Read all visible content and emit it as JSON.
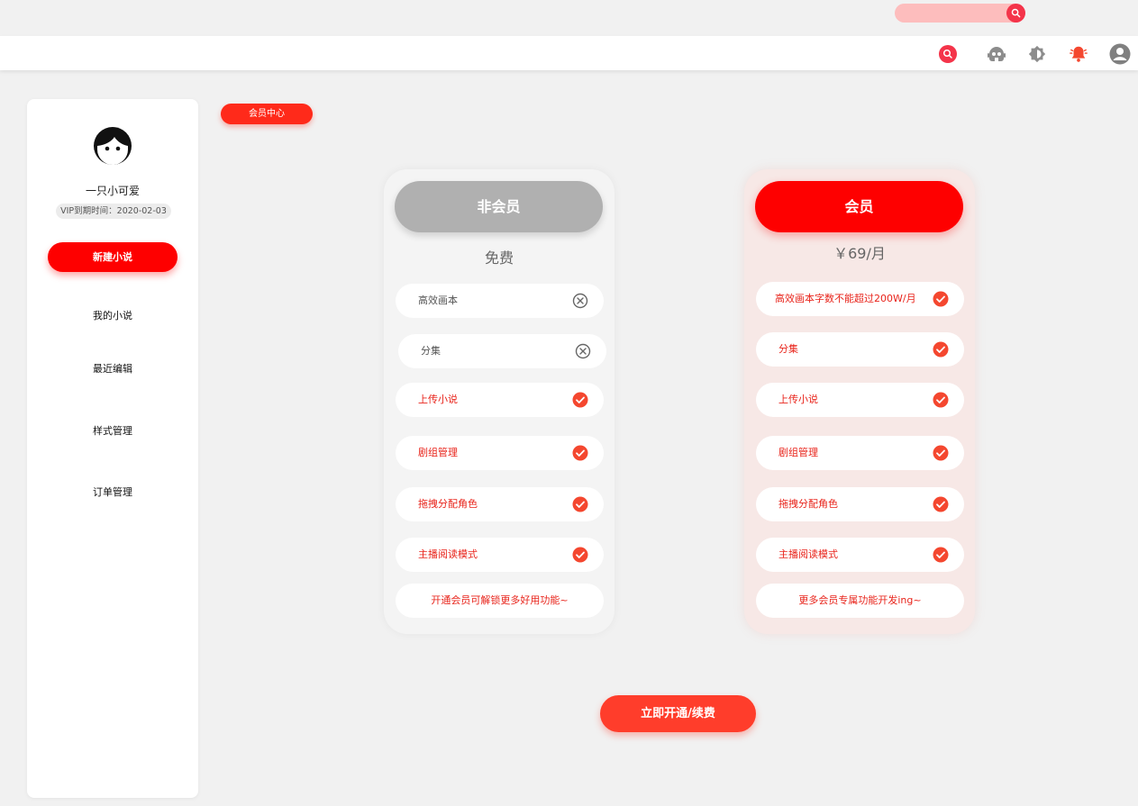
{
  "colors": {
    "accent": "#fe0000",
    "accent_soft": "#ff3d2b",
    "vip_card_bg": "#f7e8e6",
    "free_card_bg": "#f4f4f4",
    "gray_btn": "#b0b0b0"
  },
  "top_search": {
    "placeholder": "",
    "icon": "search-icon"
  },
  "header": {
    "icons": [
      "search-icon",
      "robot-icon",
      "theme-icon",
      "bell-icon",
      "user-icon"
    ]
  },
  "sidebar": {
    "username": "一只小可爱",
    "vip_expiry": "VIP到期时间：2020-02-03",
    "new_button": "新建小说",
    "items": [
      {
        "label": "我的小说"
      },
      {
        "label": "最近编辑"
      },
      {
        "label": "样式管理"
      },
      {
        "label": "订单管理"
      }
    ]
  },
  "page_tag": "会员中心",
  "plans": {
    "free": {
      "title": "非会员",
      "price": "免费",
      "features": [
        {
          "label": "高效画本",
          "included": false
        },
        {
          "label": "分集",
          "included": false
        },
        {
          "label": "上传小说",
          "included": true
        },
        {
          "label": "剧组管理",
          "included": true
        },
        {
          "label": "拖拽分配角色",
          "included": true
        },
        {
          "label": "主播阅读模式",
          "included": true
        }
      ],
      "note": "开通会员可解锁更多好用功能~"
    },
    "vip": {
      "title": "会员",
      "price": "￥69/月",
      "features": [
        {
          "label": "高效画本字数不能超过200W/月",
          "included": true
        },
        {
          "label": "分集",
          "included": true
        },
        {
          "label": "上传小说",
          "included": true
        },
        {
          "label": "剧组管理",
          "included": true
        },
        {
          "label": "拖拽分配角色",
          "included": true
        },
        {
          "label": "主播阅读模式",
          "included": true
        }
      ],
      "note": "更多会员专属功能开发ing~"
    }
  },
  "cta_button": "立即开通/续费"
}
